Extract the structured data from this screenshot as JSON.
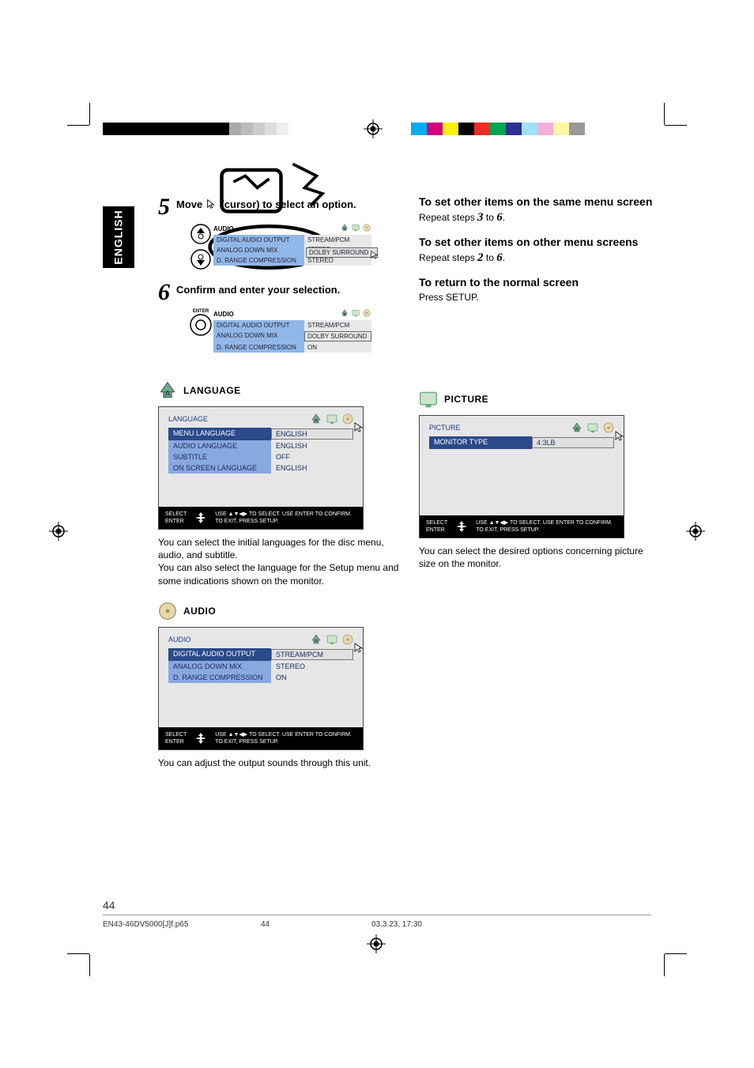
{
  "lang_tab": "ENGLISH",
  "step5": {
    "num": "5",
    "text_a": "Move ",
    "text_b": " (cursor)  to select an option.",
    "menu": {
      "title": "AUDIO",
      "rows": [
        {
          "k": "DIGITAL AUDIO OUTPUT",
          "v": "STREAM/PCM"
        },
        {
          "k": "ANALOG DOWN MIX",
          "v": "STEREO"
        },
        {
          "k": "D. RANGE COMPRESSION",
          "v": "STEREO"
        }
      ],
      "dropdown": "DOLBY SURROUND"
    }
  },
  "step6": {
    "num": "6",
    "text": "Confirm and enter your selection.",
    "enter_label": "ENTER",
    "menu": {
      "title": "AUDIO",
      "rows": [
        {
          "k": "DIGITAL AUDIO OUTPUT",
          "v": "STREAM/PCM"
        },
        {
          "k": "ANALOG DOWN MIX",
          "v": "DOLBY SURROUND"
        },
        {
          "k": "D. RANGE COMPRESSION",
          "v": "ON"
        }
      ]
    }
  },
  "language_section": {
    "heading": "LANGUAGE",
    "menu": {
      "title": "LANGUAGE",
      "rows": [
        {
          "k": "MENU LANGUAGE",
          "v": "ENGLISH",
          "boxed": true,
          "hl": true
        },
        {
          "k": "AUDIO LANGUAGE",
          "v": "ENGLISH"
        },
        {
          "k": "SUBTITLE",
          "v": "OFF"
        },
        {
          "k": "ON SCREEN LANGUAGE",
          "v": "ENGLISH"
        }
      ]
    },
    "desc": "You can select the initial languages for the disc menu, audio, and subtitle.\nYou can also select the language for the Setup menu and some indications shown on the monitor."
  },
  "audio_section": {
    "heading": "AUDIO",
    "menu": {
      "title": "AUDIO",
      "rows": [
        {
          "k": "DIGITAL AUDIO OUTPUT",
          "v": "STREAM/PCM",
          "boxed": true,
          "hl": true
        },
        {
          "k": "ANALOG DOWN MIX",
          "v": "STEREO"
        },
        {
          "k": "D. RANGE COMPRESSION",
          "v": "ON"
        }
      ]
    },
    "desc": "You can adjust the output sounds through this unit."
  },
  "right_col": {
    "h1": "To set other items on the same menu screen",
    "t1a": "Repeat steps ",
    "t1b": "3",
    "t1c": " to ",
    "t1d": "6",
    "t1e": ".",
    "h2": "To set other items on other menu screens",
    "t2a": "Repeat steps ",
    "t2b": "2",
    "t2c": " to ",
    "t2d": "6",
    "t2e": ".",
    "h3": "To return to the normal screen",
    "t3": "Press SETUP."
  },
  "picture_section": {
    "heading": "PICTURE",
    "menu": {
      "title": "PICTURE",
      "rows": [
        {
          "k": "MONITOR TYPE",
          "v": "4:3LB",
          "boxed": true,
          "hl": true
        }
      ]
    },
    "desc": "You can select the desired options concerning picture size on the monitor."
  },
  "osd_footer": {
    "select": "SELECT",
    "enter": "ENTER",
    "hint1": "USE ▲▼◀▶ TO SELECT.  USE ENTER TO CONFIRM.",
    "hint2": "TO EXIT, PRESS SETUP."
  },
  "page_num": "44",
  "file_footer": {
    "file": "EN43-46DV5000[J]f.p65",
    "page": "44",
    "ts": "03.3.23, 17:30"
  }
}
